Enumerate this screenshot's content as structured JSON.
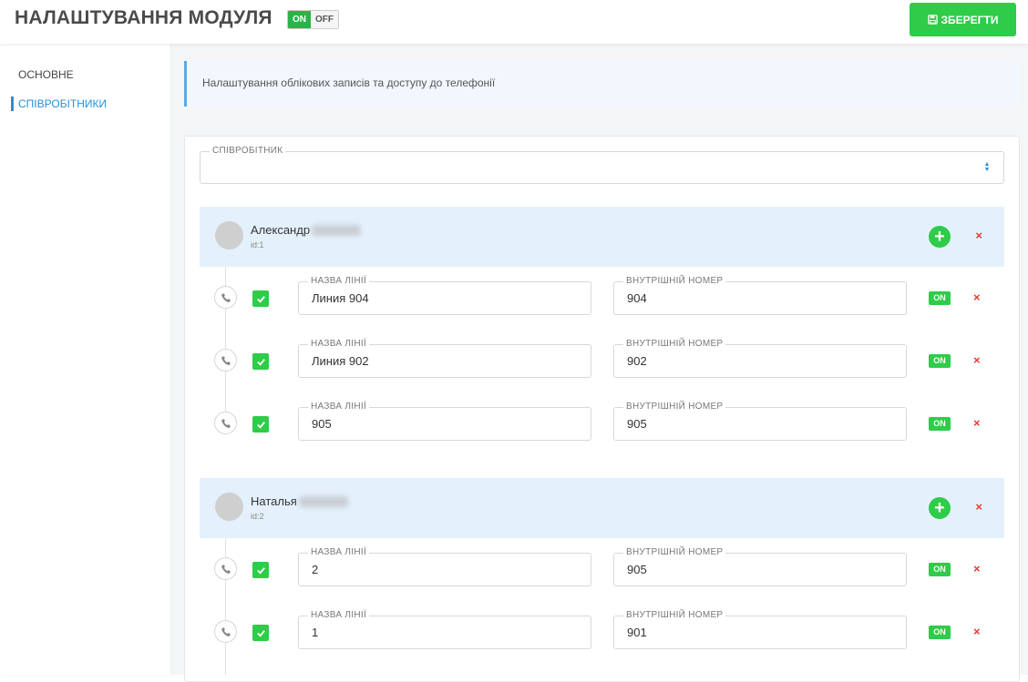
{
  "header": {
    "title": "НАЛАШТУВАННЯ МОДУЛЯ",
    "toggle_on": "ON",
    "toggle_off": "OFF",
    "save_label": "ЗБЕРЕГТИ"
  },
  "sidebar": {
    "items": [
      {
        "label": "ОСНОВНЕ",
        "active": false
      },
      {
        "label": "СПІВРОБІТНИКИ",
        "active": true
      }
    ]
  },
  "info": {
    "text": "Налаштування облікових записів та доступу до телефонії"
  },
  "employee_select": {
    "legend": "СПІВРОБІТНИК",
    "value": ""
  },
  "labels": {
    "line_name": "НАЗВА ЛІНІЇ",
    "internal_number": "ВНУТРІШНІЙ НОМЕР",
    "on": "ON",
    "delete": "×",
    "add": "+"
  },
  "employees": [
    {
      "name": "Александр",
      "id": "id:1",
      "lines": [
        {
          "line_name": "Линия 904",
          "internal_number": "904",
          "enabled": true,
          "status": "ON"
        },
        {
          "line_name": "Линия 902",
          "internal_number": "902",
          "enabled": true,
          "status": "ON"
        },
        {
          "line_name": "905",
          "internal_number": "905",
          "enabled": true,
          "status": "ON"
        }
      ]
    },
    {
      "name": "Наталья",
      "id": "id:2",
      "lines": [
        {
          "line_name": "2",
          "internal_number": "905",
          "enabled": true,
          "status": "ON"
        },
        {
          "line_name": "1",
          "internal_number": "901",
          "enabled": true,
          "status": "ON"
        }
      ]
    }
  ],
  "colors": {
    "accent_green": "#2ecc48",
    "accent_blue": "#2a8fd8",
    "danger_red": "#e53935",
    "employee_header_bg": "#e4f1fc"
  },
  "icons": {
    "save": "floppy-disk-icon",
    "phone": "phone-icon",
    "check": "checkmark-icon",
    "select": "sort-arrows-icon"
  }
}
